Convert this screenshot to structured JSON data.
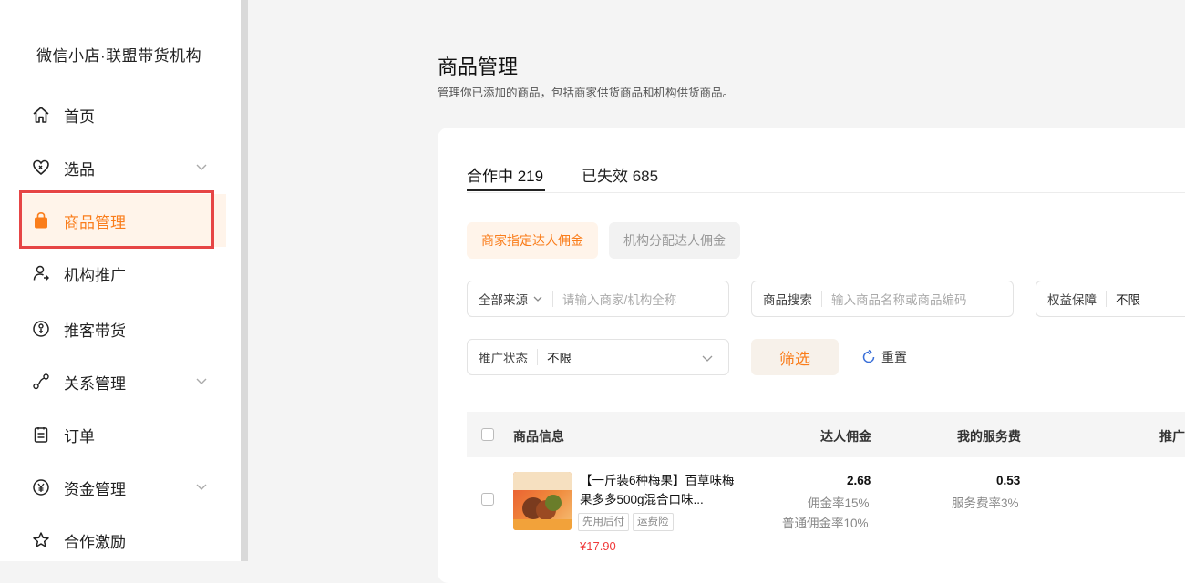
{
  "sidebar": {
    "brand": "微信小店·联盟带货机构",
    "items": [
      {
        "label": "首页",
        "icon": "home-icon"
      },
      {
        "label": "选品",
        "icon": "heart-tag-icon",
        "has_chevron": true
      },
      {
        "label": "商品管理",
        "icon": "shopping-bag-icon",
        "active": true
      },
      {
        "label": "机构推广",
        "icon": "user-promote-icon"
      },
      {
        "label": "推客带货",
        "icon": "promoter-icon"
      },
      {
        "label": "关系管理",
        "icon": "relation-icon",
        "has_chevron": true
      },
      {
        "label": "订单",
        "icon": "order-icon"
      },
      {
        "label": "资金管理",
        "icon": "yuan-icon",
        "has_chevron": true
      },
      {
        "label": "合作激励",
        "icon": "star-icon"
      }
    ]
  },
  "page": {
    "title": "商品管理",
    "subtitle": "管理你已添加的商品，包括商家供货商品和机构供货商品。"
  },
  "tabs": [
    {
      "label": "合作中 219",
      "active": true
    },
    {
      "label": "已失效 685",
      "active": false
    }
  ],
  "chips": [
    {
      "label": "商家指定达人佣金",
      "active": true
    },
    {
      "label": "机构分配达人佣金",
      "active": false
    }
  ],
  "filters": {
    "source": {
      "label": "全部来源",
      "placeholder": "请输入商家/机构全称"
    },
    "search": {
      "label": "商品搜索",
      "placeholder": "输入商品名称或商品编码"
    },
    "benefit": {
      "label": "权益保障",
      "value": "不限"
    },
    "status": {
      "label": "推广状态",
      "value": "不限"
    },
    "filter_button": "筛选",
    "reset_button": "重置"
  },
  "table": {
    "columns": [
      "商品信息",
      "达人佣金",
      "我的服务费",
      "推广"
    ],
    "rows": [
      {
        "name": "【一斤装6种梅果】百草味梅果多多500g混合口味...",
        "tags": [
          "先用后付",
          "运费险"
        ],
        "price": "¥17.90",
        "commission": "2.68",
        "commission_rate": "佣金率15%",
        "normal_rate": "普通佣金率10%",
        "service_fee": "0.53",
        "service_rate": "服务费率3%"
      }
    ]
  },
  "colors": {
    "accent": "#fa7d1b",
    "accent_bg": "#fff4ea",
    "highlight_border": "#e64545",
    "price": "#f03a3a"
  }
}
